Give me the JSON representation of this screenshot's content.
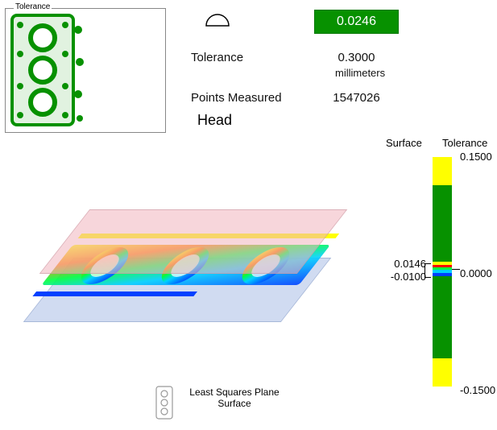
{
  "thumb": {
    "label": "Tolerance"
  },
  "result": {
    "value": "0.0246",
    "pass_color": "#079100"
  },
  "stats": {
    "tolerance_label": "Tolerance",
    "tolerance_value": "0.3000",
    "units": "millimeters",
    "points_label": "Points Measured",
    "points_value": "1547026",
    "name": "Head"
  },
  "scale": {
    "surface_header": "Surface",
    "tolerance_header": "Tolerance",
    "max": "0.1500",
    "zero": "0.0000",
    "min": "-0.1500",
    "range_hi": "0.0146",
    "range_lo": "-0.0100"
  },
  "footer": {
    "line1": "Least Squares Plane",
    "line2": "Surface"
  },
  "colors": {
    "green": "#079100",
    "yellow": "#FFFF00",
    "red": "#FF0000",
    "cyan": "#00D0FF",
    "blue": "#0040FF"
  }
}
